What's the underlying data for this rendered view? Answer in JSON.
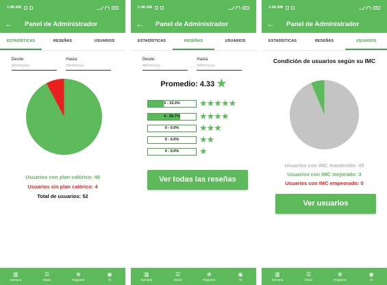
{
  "status_bar": {
    "time": "1:46 AM"
  },
  "app": {
    "title": "Panel de Administrador",
    "back_icon": "back-arrow-icon"
  },
  "tabs": [
    "ESTADÍSTICAS",
    "RESEÑAS",
    "USUARIOS"
  ],
  "nav": [
    {
      "label": "Semana",
      "icon": "bar-chart-icon"
    },
    {
      "label": "Diario",
      "icon": "list-icon"
    },
    {
      "label": "Registrar",
      "icon": "add-circle-icon"
    },
    {
      "label": "Yo",
      "icon": "person-icon"
    }
  ],
  "colors": {
    "primary": "#5cba5b",
    "red": "#e8211f",
    "gray": "#c4c4c4"
  },
  "screen1": {
    "active_tab": "ESTADÍSTICAS",
    "desde_label": "Desde:",
    "hasta_label": "Hasta:",
    "date_placeholder": "dd/mm/yyyy",
    "con_plan": "Usuarios con plan calórico: 48",
    "sin_plan": "Usuarios sin plan calórico: 4",
    "total": "Total de usuarios: 52"
  },
  "screen2": {
    "active_tab": "RESEÑAS",
    "desde_label": "Desde:",
    "hasta_label": "Hasta:",
    "date_placeholder": "dd/mm/yyyy",
    "promedio": "Promedio: 4.33",
    "ratings": [
      {
        "label": "5 - 33.3%",
        "fraction": 0.333,
        "stars": 5
      },
      {
        "label": "4 - 66.7%",
        "fraction": 0.667,
        "stars": 4
      },
      {
        "label": "0 - 0.0%",
        "fraction": 0.0,
        "stars": 3
      },
      {
        "label": "0 - 0.0%",
        "fraction": 0.0,
        "stars": 2
      },
      {
        "label": "0 - 0.0%",
        "fraction": 0.0,
        "stars": 1
      }
    ],
    "button": "Ver todas las reseñas"
  },
  "screen3": {
    "active_tab": "USUARIOS",
    "title": "Condición de usuarios según su IMC",
    "mantenido": "Usuarios con IMC mantenido: 45",
    "mejorado": "Usuarios con IMC mejorado: 3",
    "empeorado": "Usuarios con IMC empeorado: 0",
    "button": "Ver usuarios"
  },
  "chart_data": [
    {
      "type": "pie",
      "categories": [
        "Usuarios con plan calórico",
        "Usuarios sin plan calórico"
      ],
      "values": [
        48,
        4
      ],
      "colors": [
        "#5cba5b",
        "#e8211f"
      ]
    },
    {
      "type": "pie",
      "categories": [
        "Usuarios con IMC mantenido",
        "Usuarios con IMC mejorado",
        "Usuarios con IMC empeorado"
      ],
      "values": [
        45,
        3,
        0
      ],
      "colors": [
        "#c4c4c4",
        "#5cba5b",
        "#e8211f"
      ]
    }
  ]
}
